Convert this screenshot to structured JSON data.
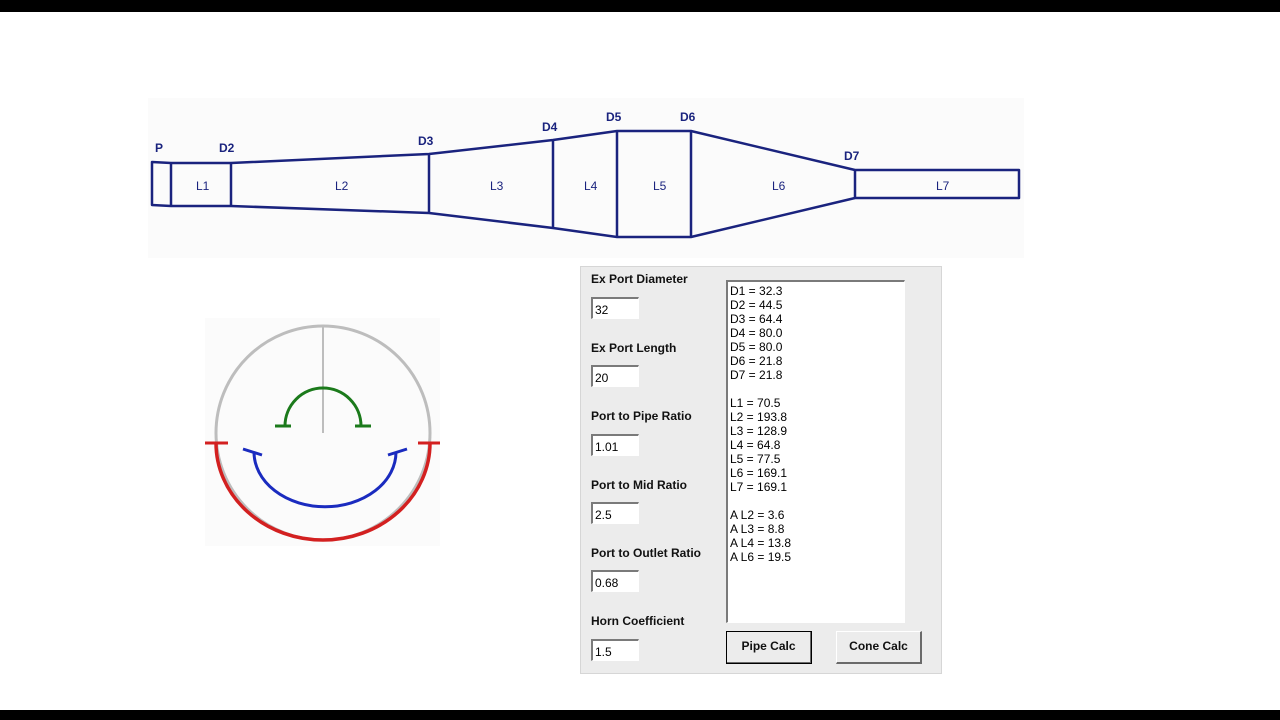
{
  "diagram": {
    "diameter_labels": [
      "P",
      "D2",
      "D3",
      "D4",
      "D5",
      "D6",
      "D7"
    ],
    "section_labels": [
      "L1",
      "L2",
      "L3",
      "L4",
      "L5",
      "L6",
      "L7"
    ],
    "line_color": "#1a237e"
  },
  "cone_diagram": {
    "colors": {
      "outline": "#bdbdbd",
      "top_arc": "#1b7a1b",
      "inner_arc": "#1a2bbf",
      "outer_arc": "#d32020"
    }
  },
  "inputs": [
    {
      "label": "Ex Port Diameter",
      "value": "32"
    },
    {
      "label": "Ex Port Length",
      "value": "20"
    },
    {
      "label": "Port to Pipe Ratio",
      "value": "1.01"
    },
    {
      "label": "Port to Mid Ratio",
      "value": "2.5"
    },
    {
      "label": "Port to Outlet Ratio",
      "value": "0.68"
    },
    {
      "label": "Horn Coefficient",
      "value": "1.5"
    }
  ],
  "results": {
    "diameters": [
      "D1 = 32.3",
      "D2 = 44.5",
      "D3 = 64.4",
      "D4 = 80.0",
      "D5 = 80.0",
      "D6 = 21.8",
      "D7 = 21.8"
    ],
    "lengths": [
      "L1 = 70.5",
      "L2 = 193.8",
      "L3 = 128.9",
      "L4 = 64.8",
      "L5 = 77.5",
      "L6 = 169.1",
      "L7 = 169.1"
    ],
    "angles": [
      "A L2 = 3.6",
      "A L3 = 8.8",
      "A L4 = 13.8",
      "A L6 = 19.5"
    ]
  },
  "buttons": {
    "pipe_calc": "Pipe Calc",
    "cone_calc": "Cone Calc"
  }
}
